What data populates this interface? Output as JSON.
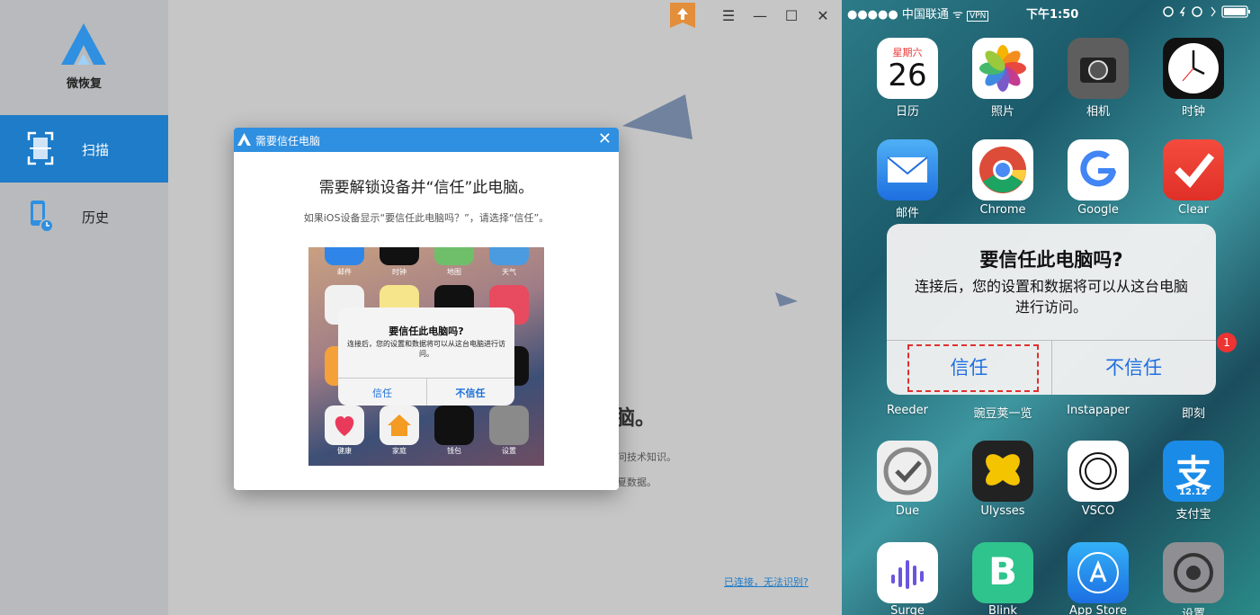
{
  "app": {
    "name": "微恢复",
    "nav": [
      {
        "label": "扫描",
        "icon": "scan-icon",
        "active": true
      },
      {
        "label": "历史",
        "icon": "history-icon",
        "active": false
      }
    ],
    "window_controls": [
      "menu-icon",
      "minimize-icon",
      "maximize-icon",
      "close-icon"
    ],
    "background": {
      "heading_fragment": "脑。",
      "line1_fragment": "问技术知识。",
      "line2_fragment": "夏数据。",
      "link": "已连接，无法识别?"
    },
    "accent": "#1e7cc8"
  },
  "dialog": {
    "title": "需要信任电脑",
    "heading": "需要解锁设备并“信任”此电脑。",
    "subtitle": "如果iOS设备显示“要信任此电脑吗？”，请选择“信任”。",
    "preview": {
      "top_labels": [
        "邮件",
        "时钟",
        "地图",
        "天气"
      ],
      "bottom_labels": [
        "健康",
        "家庭",
        "钱包",
        "设置"
      ],
      "alert_title": "要信任此电脑吗?",
      "alert_body": "连接后，您的设置和数据将可以从这台电脑进行访问。",
      "trust": "信任",
      "distrust": "不信任"
    }
  },
  "phone": {
    "carrier": "●●●●● 中国联通",
    "vpn": "VPN",
    "time": "下午1:50",
    "calendar": {
      "weekday": "星期六",
      "day": "26"
    },
    "apps_row1": [
      "日历",
      "照片",
      "相机",
      "时钟"
    ],
    "apps_row2": [
      "邮件",
      "Chrome",
      "Google",
      "Clear"
    ],
    "apps_row3": [
      "Reeder",
      "豌豆荚一览",
      "Instapaper",
      "即刻"
    ],
    "apps_row4": [
      "Due",
      "Ulysses",
      "VSCO",
      "支付宝"
    ],
    "apps_row5": [
      "Surge",
      "Blink",
      "App Store",
      "设置"
    ],
    "alipay_badge": "12.12",
    "badge": "1",
    "alert": {
      "title": "要信任此电脑吗?",
      "body": "连接后，您的设置和数据将可以从这台电脑进行访问。",
      "trust": "信任",
      "distrust": "不信任"
    }
  }
}
